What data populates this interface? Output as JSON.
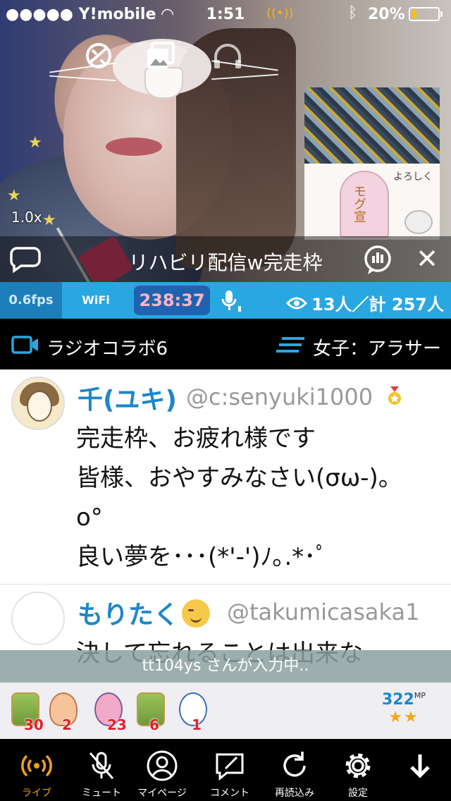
{
  "status_bar": {
    "carrier": "●●●●● Y!mobile",
    "time": "1:51",
    "live_indicator": "((•))",
    "battery": "20%",
    "battery_level": 0.2
  },
  "video": {
    "zoom": "1.0x",
    "title": "リハビリ配信w完走枠",
    "thumb_text": "よろしく",
    "thumb_badge": "モグ宣"
  },
  "stats": {
    "fps": "0.6fps",
    "network": "WiFi",
    "timer": "238:37",
    "viewers": "13人／計 257人"
  },
  "category": {
    "name": "ラジオコラボ6",
    "tag": "女子：アラサー"
  },
  "comments": [
    {
      "name": "千(ユキ)",
      "handle": "@c:senyuki1000",
      "lines": [
        "完走枠、お疲れ様です",
        "皆様、おやすみなさい(σω-)。",
        "o°",
        "良い夢を･･･(*'-')ﾉ｡.*･ﾟ"
      ]
    },
    {
      "name": "もりたく",
      "handle": "@takumicasaka1",
      "lines": [
        "決して忘れることは出来な"
      ]
    }
  ],
  "typing": "tt104ys さんが入力中..",
  "gifts": [
    {
      "icon": "tea-cup-icon",
      "count": "30"
    },
    {
      "icon": "clapping-hands-icon",
      "count": "2"
    },
    {
      "icon": "pink-bear-icon",
      "count": "23"
    },
    {
      "icon": "tea-plus10-icon",
      "count": "6"
    },
    {
      "icon": "bird-character-icon",
      "count": "1"
    }
  ],
  "mp": {
    "value": "322",
    "unit": "MP",
    "stars": "★★"
  },
  "tabs": [
    {
      "label": "ライブ",
      "icon": "live-broadcast-icon",
      "active": true
    },
    {
      "label": "ミュート",
      "icon": "mute-mic-icon"
    },
    {
      "label": "マイページ",
      "icon": "profile-icon"
    },
    {
      "label": "コメント",
      "icon": "comment-edit-icon"
    },
    {
      "label": "再読込み",
      "icon": "reload-icon"
    },
    {
      "label": "設定",
      "icon": "settings-gear-icon"
    },
    {
      "label": "",
      "icon": "down-arrow-icon"
    }
  ],
  "colors": {
    "accent_blue": "#29a7e0",
    "live_orange": "#f0a01a",
    "name_blue": "#1e86c9"
  }
}
